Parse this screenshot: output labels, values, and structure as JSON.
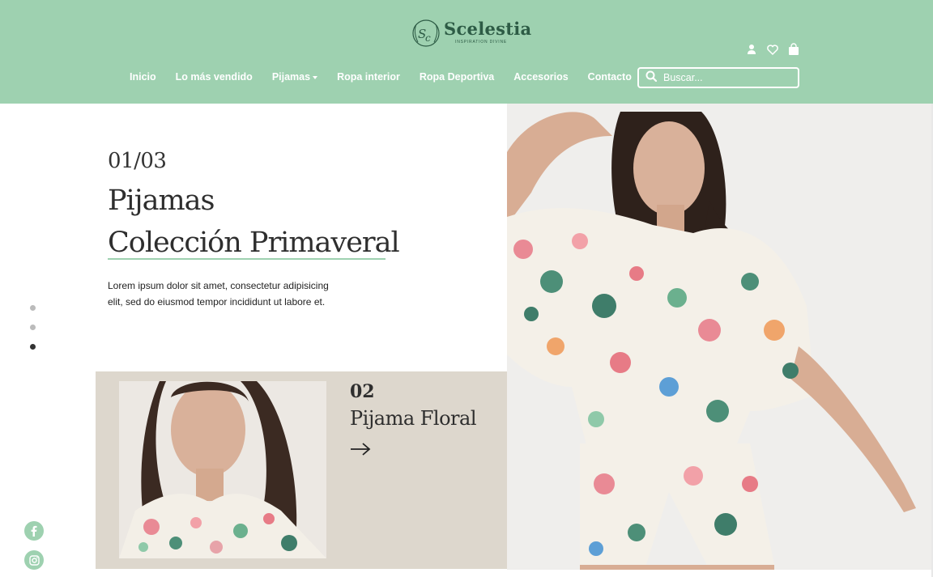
{
  "brand": {
    "name": "Scelestia",
    "tagline": "INSPIRATION DIVINE",
    "logo_icon": "sc-monogram-wreath"
  },
  "header_icons": [
    "user-icon",
    "heart-icon",
    "shopping-bag-icon"
  ],
  "nav": {
    "items": [
      {
        "label": "Inicio"
      },
      {
        "label": "Lo más vendido"
      },
      {
        "label": "Pijamas",
        "has_dropdown": true
      },
      {
        "label": "Ropa interior"
      },
      {
        "label": "Ropa Deportiva"
      },
      {
        "label": "Accesorios"
      },
      {
        "label": "Contacto"
      }
    ]
  },
  "search": {
    "placeholder": "Buscar...",
    "icon": "search-icon"
  },
  "hero": {
    "counter": "01/03",
    "title_line1": "Pijamas",
    "title_line2": "Colección Primaveral",
    "description": "Lorem ipsum dolor sit amet, consectetur adipisicing elit, sed do eiusmod tempor incididunt ut labore et."
  },
  "slider": {
    "total": 3,
    "active_index": 2
  },
  "feature": {
    "number": "02",
    "title": "Pijama Floral",
    "arrow_icon": "arrow-right-icon"
  },
  "socials": [
    "facebook-icon",
    "instagram-icon"
  ],
  "colors": {
    "header_bg": "#9ed1b0",
    "card_bg": "#ddd7cd",
    "accent": "#9ed1b0",
    "text_dark": "#2e2e2e"
  }
}
